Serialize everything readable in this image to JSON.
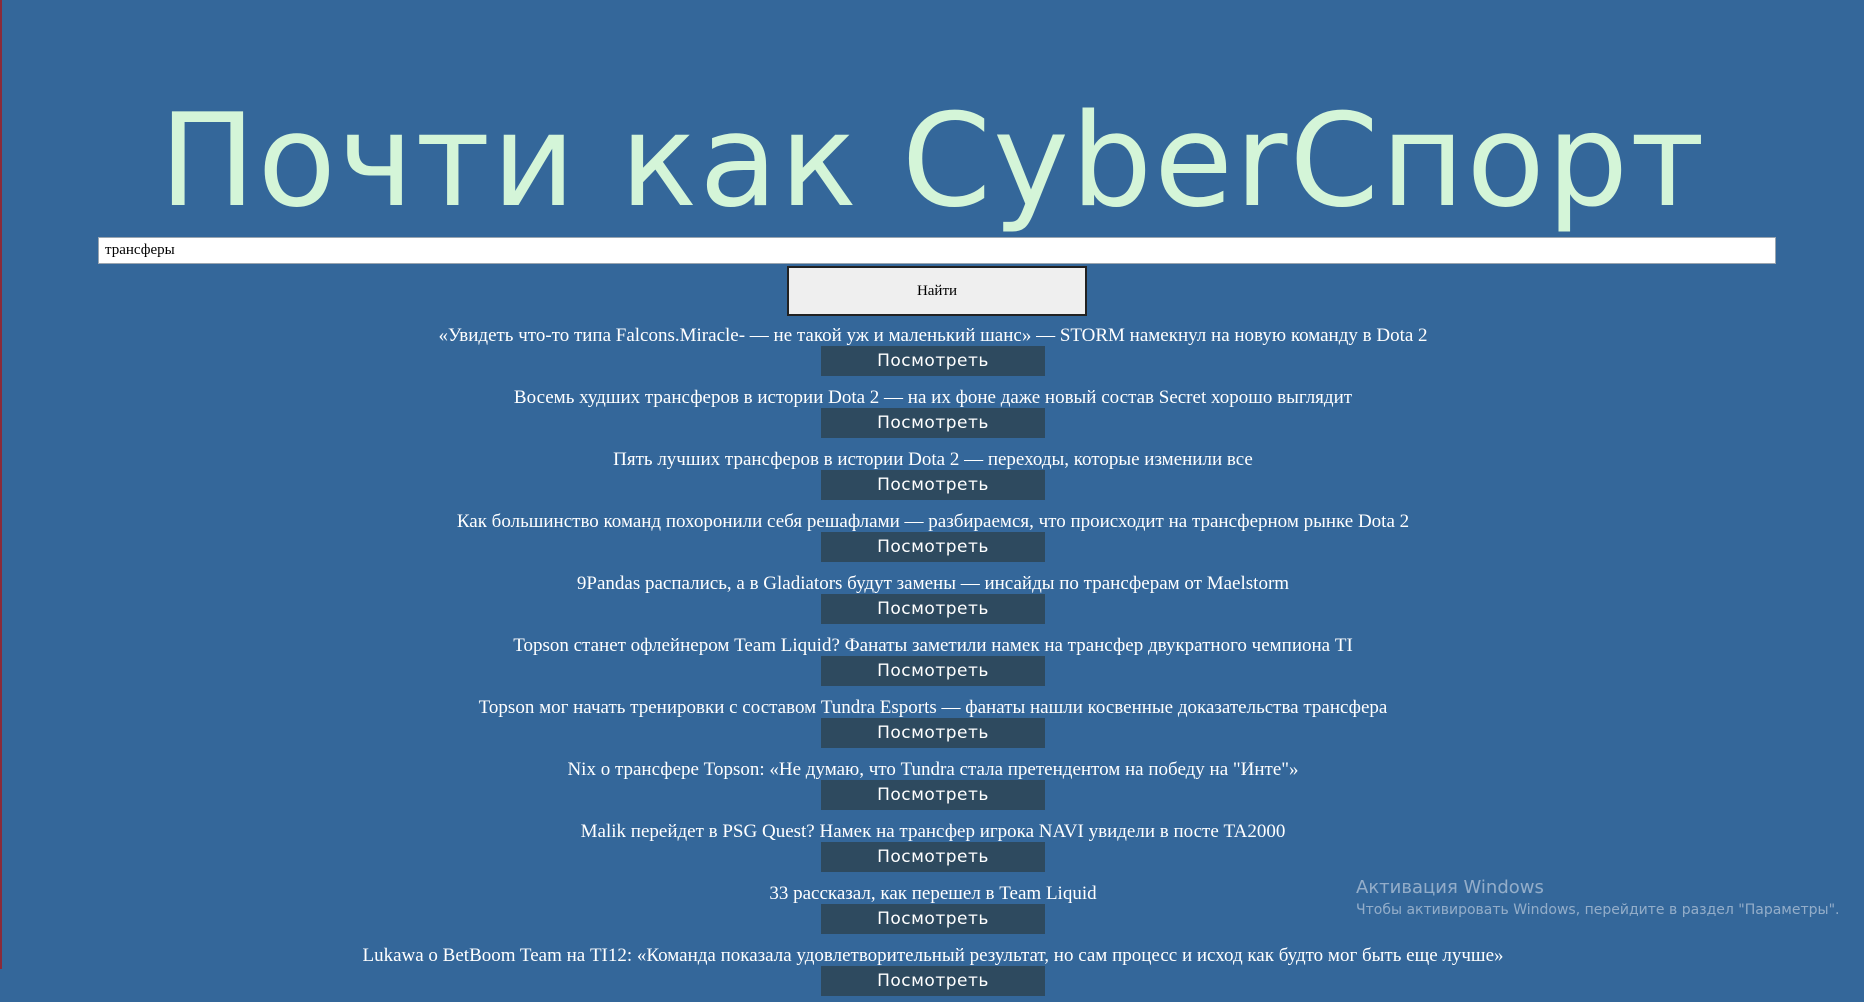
{
  "site": {
    "title": "Почти как CyberСпорт"
  },
  "search": {
    "value": "трансферы",
    "button_label": "Найти"
  },
  "results": [
    {
      "title": "«Увидеть что-то типа Falcons.Miracle- — не такой уж и маленький шанс» — STORM намекнул на новую команду в Dota 2",
      "button_label": "Посмотреть"
    },
    {
      "title": "Восемь худших трансферов в истории Dota 2 — на их фоне даже новый состав Secret хорошо выглядит",
      "button_label": "Посмотреть"
    },
    {
      "title": "Пять лучших трансферов в истории Dota 2 — переходы, которые изменили все",
      "button_label": "Посмотреть"
    },
    {
      "title": "Как большинство команд похоронили себя решафлами — разбираемся, что происходит на трансферном рынке Dota 2",
      "button_label": "Посмотреть"
    },
    {
      "title": "9Pandas распались, а в Gladiators будут замены — инсайды по трансферам от Maelstorm",
      "button_label": "Посмотреть"
    },
    {
      "title": "Topson станет офлейнером Team Liquid? Фанаты заметили намек на трансфер двукратного чемпиона TI",
      "button_label": "Посмотреть"
    },
    {
      "title": "Topson мог начать тренировки с составом Tundra Esports — фанаты нашли косвенные доказательства трансфера",
      "button_label": "Посмотреть"
    },
    {
      "title": "Nix о трансфере Topson: «Не думаю, что Tundra стала претендентом на победу на \"Инте\"»",
      "button_label": "Посмотреть"
    },
    {
      "title": "Malik перейдет в PSG Quest? Намек на трансфер игрока NAVI увидели в посте TA2000",
      "button_label": "Посмотреть"
    },
    {
      "title": "33 рассказал, как перешел в Team Liquid",
      "button_label": "Посмотреть"
    },
    {
      "title": "Lukawa о BetBoom Team на TI12: «Команда показала удовлетворительный результат, но сам процесс и исход как будто мог быть еще лучше»",
      "button_label": "Посмотреть"
    }
  ],
  "watermark": {
    "title": "Активация Windows",
    "text": "Чтобы активировать Windows, перейдите в раздел \"Параметры\"."
  }
}
